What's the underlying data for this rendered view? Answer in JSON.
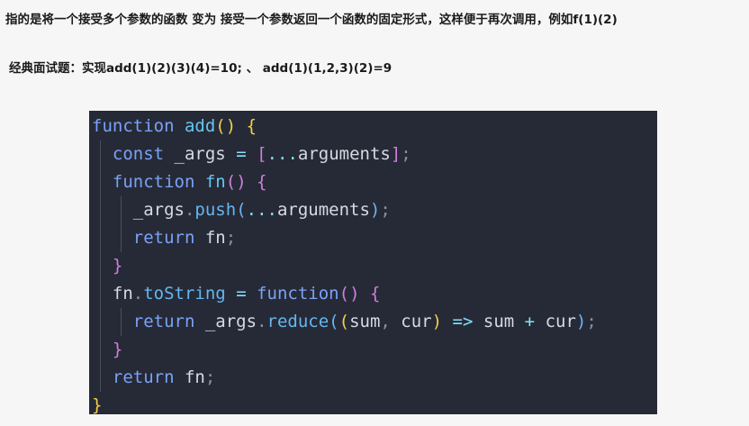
{
  "intro_text": "指的是将一个接受多个参数的函数 变为 接受一个参数返回一个函数的固定形式，这样便于再次调用，例如f(1)(2)",
  "question_text": "经典面试题：实现add(1)(2)(3)(4)=10; 、 add(1)(1,2,3)(2)=9",
  "code": {
    "line1": {
      "kw": "function",
      "name": "add",
      "paren": "()",
      "brace": "{"
    },
    "line2": {
      "kw": "const",
      "var": "_args",
      "eq": "=",
      "bracket_open": "[",
      "spread": "...",
      "args": "arguments",
      "bracket_close": "]",
      "semi": ";"
    },
    "line3": {
      "kw": "function",
      "name": "fn",
      "paren": "()",
      "brace": "{"
    },
    "line4": {
      "obj": "_args",
      "dot": ".",
      "method": "push",
      "paren_open": "(",
      "spread": "...",
      "args": "arguments",
      "paren_close": ")",
      "semi": ";"
    },
    "line5": {
      "kw": "return",
      "value": "fn",
      "semi": ";"
    },
    "line6": {
      "brace": "}"
    },
    "line7": {
      "obj": "fn",
      "dot": ".",
      "method": "toString",
      "eq": "=",
      "kw": "function",
      "paren": "()",
      "brace": "{"
    },
    "line8": {
      "kw": "return",
      "obj": "_args",
      "dot": ".",
      "method": "reduce",
      "paren_open": "(",
      "inner_open": "(",
      "p1": "sum",
      "comma": ",",
      "p2": "cur",
      "inner_close": ")",
      "arrow": "=>",
      "a": "sum",
      "plus": "+",
      "b": "cur",
      "paren_close": ")",
      "semi": ";"
    },
    "line9": {
      "brace": "}"
    },
    "line10": {
      "kw": "return",
      "value": "fn",
      "semi": ";"
    },
    "line11": {
      "brace": "}"
    }
  },
  "colors": {
    "panel_background": "#262a36",
    "keyword": "#7aa2f7",
    "function_name": "#66c6f0",
    "bracket_level1": "#f5cf47",
    "bracket_level2": "#d07ee0",
    "bracket_level3": "#6cb3f4"
  }
}
